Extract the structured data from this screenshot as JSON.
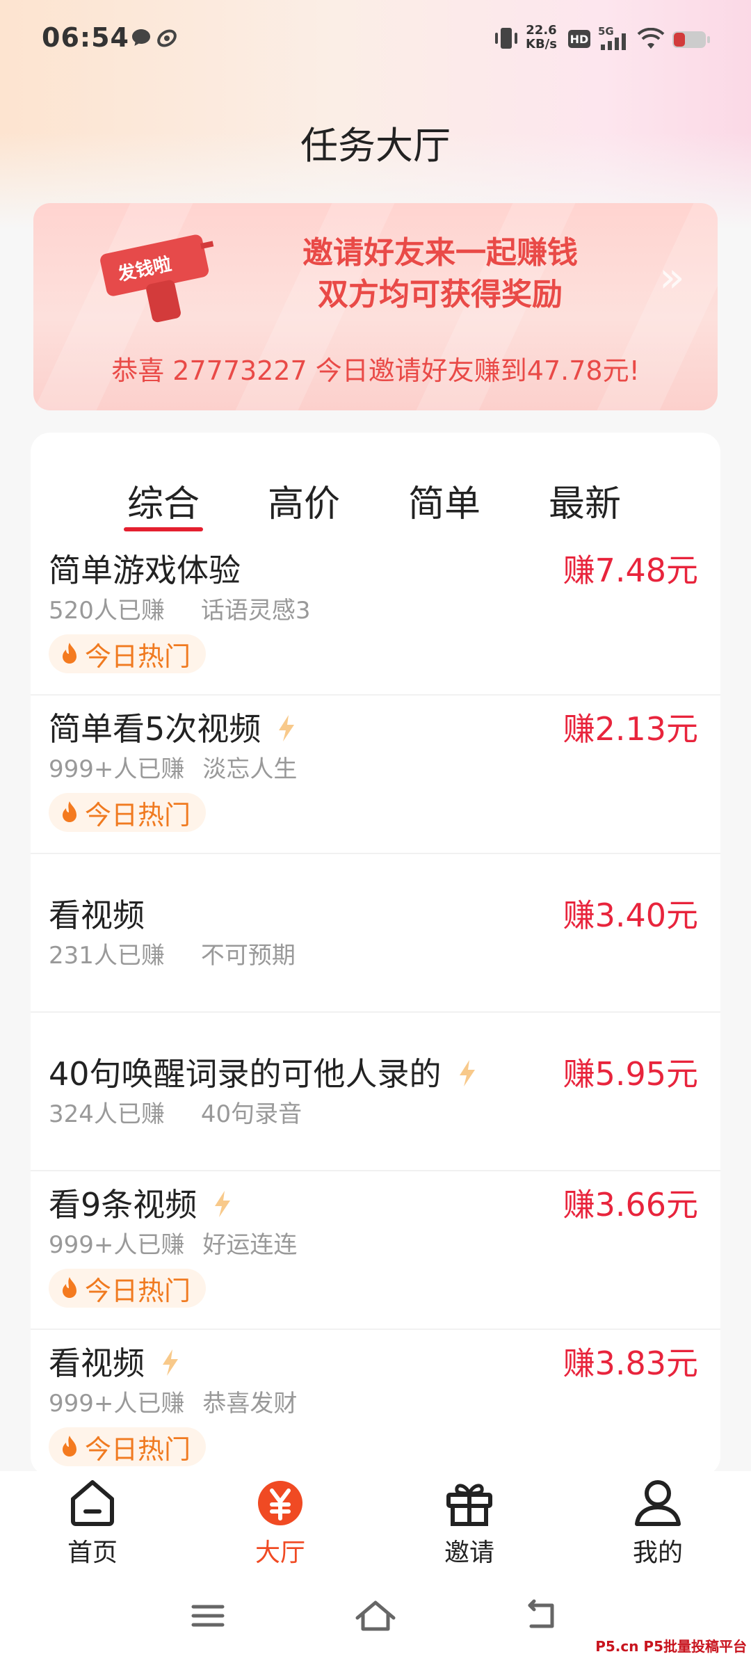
{
  "status_bar": {
    "time": "06:54",
    "net_speed_value": "22.6",
    "net_speed_unit": "KB/s",
    "hd_badge": "HD",
    "network_type": "5G"
  },
  "page": {
    "title": "任务大厅"
  },
  "banner": {
    "sticker_text": "发钱啦",
    "line1": "邀请好友来一起赚钱",
    "line2": "双方均可获得奖励",
    "arrow": "»",
    "congrats": "恭喜 27773227 今日邀请好友赚到47.78元!"
  },
  "tabs": [
    {
      "label": "综合",
      "active": true
    },
    {
      "label": "高价",
      "active": false
    },
    {
      "label": "简单",
      "active": false
    },
    {
      "label": "最新",
      "active": false
    }
  ],
  "tasks": [
    {
      "title": "简单游戏体验",
      "earned": "520人已赚",
      "user": "话语灵感3",
      "reward": "赚7.48元",
      "hot_label": "今日热门",
      "hot": true,
      "bolt": false
    },
    {
      "title": "简单看5次视频",
      "earned": "999+人已赚",
      "user": "淡忘人生",
      "reward": "赚2.13元",
      "hot_label": "今日热门",
      "hot": true,
      "bolt": true
    },
    {
      "title": "看视频",
      "earned": "231人已赚",
      "user": "不可预期",
      "reward": "赚3.40元",
      "hot": false,
      "bolt": false
    },
    {
      "title": "40句唤醒词录的可他人录的",
      "earned": "324人已赚",
      "user": "40句录音",
      "reward": "赚5.95元",
      "hot": false,
      "bolt": true
    },
    {
      "title": "看9条视频",
      "earned": "999+人已赚",
      "user": "好运连连",
      "reward": "赚3.66元",
      "hot_label": "今日热门",
      "hot": true,
      "bolt": true
    },
    {
      "title": "看视频",
      "earned": "999+人已赚",
      "user": "恭喜发财",
      "reward": "赚3.83元",
      "hot_label": "今日热门",
      "hot": true,
      "bolt": true
    }
  ],
  "nav": [
    {
      "label": "首页",
      "icon": "home-icon",
      "active": false
    },
    {
      "label": "大厅",
      "icon": "yuan-coin-icon",
      "active": true
    },
    {
      "label": "邀请",
      "icon": "gift-icon",
      "active": false
    },
    {
      "label": "我的",
      "icon": "profile-icon",
      "active": false
    }
  ],
  "colors": {
    "accent_red": "#e8243c",
    "tab_underline": "#e41f2f",
    "nav_active": "#f04a23",
    "hot_orange": "#f07a20",
    "banner_text": "#e94a47"
  },
  "watermark": "P5.cn P5批量投稿平台"
}
